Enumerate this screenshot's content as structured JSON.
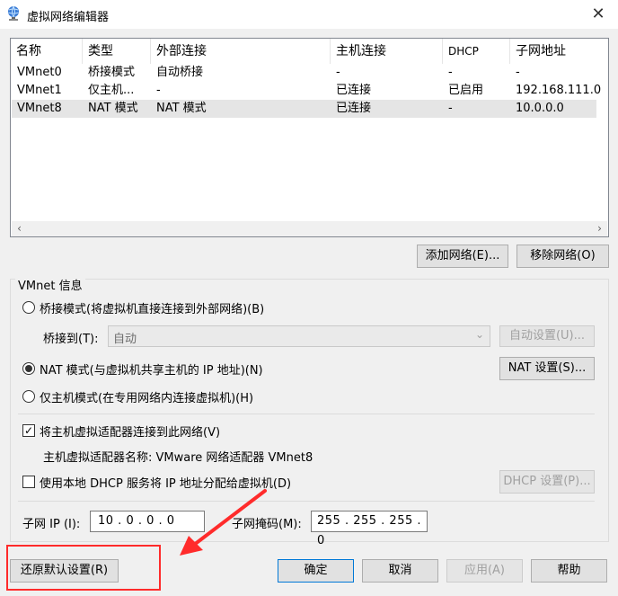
{
  "window": {
    "title": "虚拟网络编辑器",
    "close_glyph": "✕",
    "app_icon": "network-globe-icon"
  },
  "table": {
    "columns": [
      "名称",
      "类型",
      "外部连接",
      "主机连接",
      "DHCP",
      "子网地址"
    ],
    "rows": [
      [
        "VMnet0",
        "桥接模式",
        "自动桥接",
        "-",
        "-",
        "-"
      ],
      [
        "VMnet1",
        "仅主机...",
        "-",
        "已连接",
        "已启用",
        "192.168.111.0"
      ],
      [
        "VMnet8",
        "NAT 模式",
        "NAT 模式",
        "已连接",
        "-",
        "10.0.0.0"
      ]
    ],
    "selected_row": 2,
    "scroll_left": "‹",
    "scroll_right": "›"
  },
  "buttons": {
    "add_network": "添加网络(E)...",
    "remove_network": "移除网络(O)"
  },
  "vmnet_info": {
    "title": "VMnet 信息",
    "bridged": "桥接模式(将虚拟机直接连接到外部网络)(B)",
    "bridge_to_label": "桥接到(T):",
    "bridge_to_value": "自动",
    "auto_settings": "自动设置(U)...",
    "nat": "NAT 模式(与虚拟机共享主机的 IP 地址)(N)",
    "nat_settings": "NAT 设置(S)...",
    "host_only": "仅主机模式(在专用网络内连接虚拟机)(H)",
    "selected_mode": "nat",
    "connect_adapter": "将主机虚拟适配器连接到此网络(V)",
    "connect_adapter_checked": true,
    "adapter_name": "主机虚拟适配器名称: VMware 网络适配器 VMnet8",
    "use_dhcp": "使用本地 DHCP 服务将 IP 地址分配给虚拟机(D)",
    "use_dhcp_checked": false,
    "dhcp_settings": "DHCP 设置(P)...",
    "subnet_ip_label": "子网 IP (I):",
    "subnet_ip": "10 . 0 . 0 . 0",
    "subnet_mask_label": "子网掩码(M):",
    "subnet_mask": "255 . 255 . 255 . 0"
  },
  "footer": {
    "restore_defaults": "还原默认设置(R)",
    "ok": "确定",
    "cancel": "取消",
    "apply": "应用(A)",
    "help": "帮助"
  },
  "colors": {
    "annotation": "#ff2b2b",
    "primary_border": "#0078d7"
  },
  "check_glyph": "✓",
  "combo_arrow": "⌄"
}
